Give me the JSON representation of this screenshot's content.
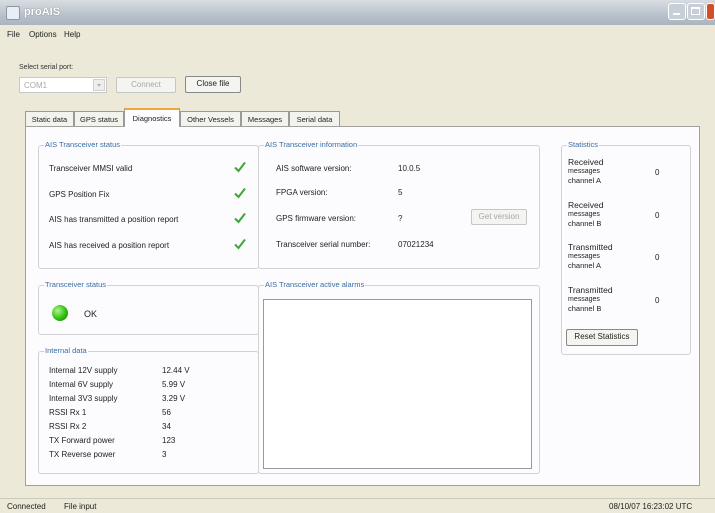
{
  "window": {
    "title": "proAIS"
  },
  "menu": [
    "File",
    "Options",
    "Help"
  ],
  "serial": {
    "label": "Select serial port:",
    "port": "COM1",
    "connect_label": "Connect",
    "close_file_label": "Close file"
  },
  "tabs": [
    "Static data",
    "GPS status",
    "Diagnostics",
    "Other Vessels",
    "Messages",
    "Serial data"
  ],
  "active_tab": "Diagnostics",
  "ais_status": {
    "title": "AIS Transceiver status",
    "items": [
      {
        "label": "Transceiver MMSI valid",
        "ok": true
      },
      {
        "label": "GPS Position Fix",
        "ok": true
      },
      {
        "label": "AIS has transmitted a position report",
        "ok": true
      },
      {
        "label": "AIS has received a position report",
        "ok": true
      }
    ]
  },
  "transceiver_status": {
    "title": "Transceiver status",
    "state": "OK",
    "color": "#2fc00f"
  },
  "internal_data": {
    "title": "Internal data",
    "rows": [
      {
        "label": "Internal 12V supply",
        "value": "12.44 V"
      },
      {
        "label": "Internal 6V supply",
        "value": "5.99 V"
      },
      {
        "label": "Internal 3V3 supply",
        "value": "3.29 V"
      },
      {
        "label": "RSSI Rx 1",
        "value": "56"
      },
      {
        "label": "RSSI Rx 2",
        "value": "34"
      },
      {
        "label": "TX Forward power",
        "value": "123"
      },
      {
        "label": "TX Reverse power",
        "value": "3"
      }
    ]
  },
  "ais_info": {
    "title": "AIS Transceiver information",
    "software_label": "AIS software version:",
    "software_value": "10.0.5",
    "fpga_label": "FPGA version:",
    "fpga_value": "5",
    "gps_fw_label": "GPS firmware version:",
    "gps_fw_value": "?",
    "get_version_label": "Get version",
    "serial_label": "Transceiver serial number:",
    "serial_value": "07021234"
  },
  "alarms": {
    "title": "AIS Transceiver active alarms",
    "items": []
  },
  "statistics": {
    "title": "Statistics",
    "rows": [
      {
        "label1": "Received",
        "label2": "messages",
        "label3": "channel A",
        "value": "0"
      },
      {
        "label1": "Received",
        "label2": "messages",
        "label3": "channel B",
        "value": "0"
      },
      {
        "label1": "Transmitted",
        "label2": "messages",
        "label3": "channel A",
        "value": "0"
      },
      {
        "label1": "Transmitted",
        "label2": "messages",
        "label3": "channel B",
        "value": "0"
      }
    ],
    "reset_label": "Reset Statistics"
  },
  "status_bar": {
    "connection": "Connected",
    "mode": "File input",
    "datetime": "08/10/07 16:23:02 UTC"
  },
  "colors": {
    "accent_tab": "#f3a63a",
    "group_title": "#3a6ca5",
    "check": "#3aa832"
  }
}
